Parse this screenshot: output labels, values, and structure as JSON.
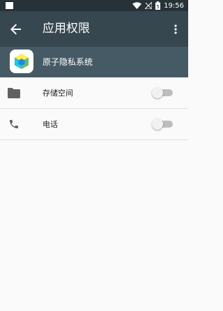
{
  "status_bar": {
    "time": "19:56",
    "battery_level": "5"
  },
  "app_bar": {
    "title": "应用权限"
  },
  "app_header": {
    "app_name": "原子隐私系统"
  },
  "permissions": [
    {
      "label": "存储空间",
      "icon": "folder-icon",
      "enabled": false
    },
    {
      "label": "电话",
      "icon": "phone-icon",
      "enabled": false
    }
  ],
  "colors": {
    "status_bar": "#263238",
    "app_bar": "#37474f",
    "app_header": "#455a64",
    "background": "#fafafa"
  }
}
